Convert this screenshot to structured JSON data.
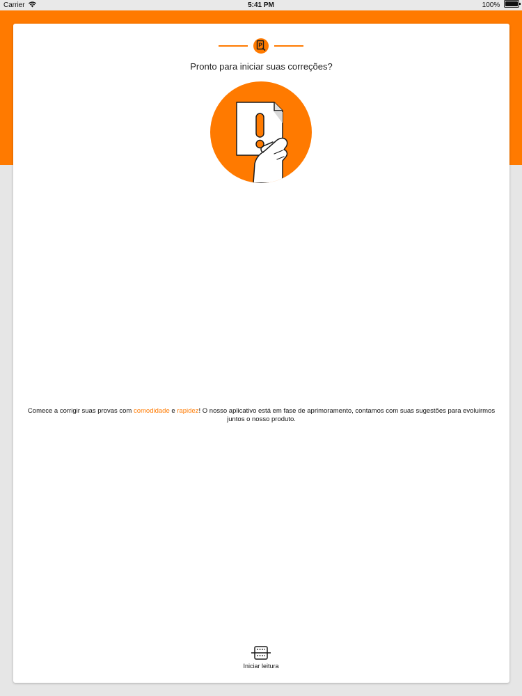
{
  "status_bar": {
    "carrier": "Carrier",
    "time": "5:41 PM",
    "battery": "100%"
  },
  "colors": {
    "accent": "#ff7a00",
    "background": "#e6e6e6",
    "card": "#ffffff"
  },
  "header": {
    "logo_icon": "p-logo-icon"
  },
  "main": {
    "headline": "Pronto para iniciar suas correções?",
    "illustration_icon": "hand-holding-paper-exclamation-icon",
    "message": {
      "part1": "Comece a corrigir suas provas com ",
      "highlight1": "comodidade",
      "part2": " e ",
      "highlight2": "rapidez",
      "part3": "! O nosso aplicativo está em fase de aprimoramento, contamos com suas sugestões para evoluirmos juntos o nosso produto."
    }
  },
  "actions": {
    "start_icon": "scan-icon",
    "start_label": "Iniciar leitura"
  }
}
